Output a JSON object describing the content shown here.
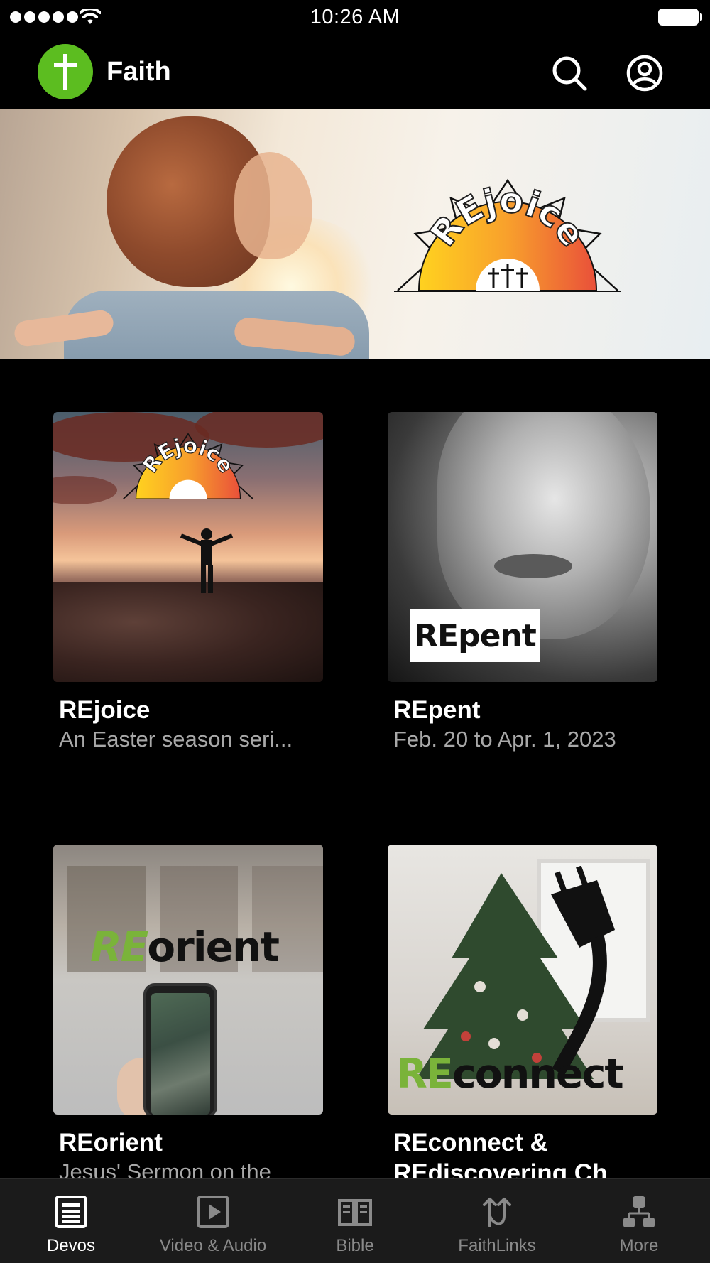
{
  "status_bar": {
    "time": "10:26 AM"
  },
  "header": {
    "app_name": "Faith",
    "logo_icon": "cross-icon",
    "search_icon": "search-icon",
    "profile_icon": "account-circle-icon",
    "accent_color": "#5cbd20"
  },
  "hero": {
    "logo_text": "REjoice"
  },
  "cards": [
    {
      "title": "REjoice",
      "subtitle": "An Easter season seri...",
      "art_text": "REjoice"
    },
    {
      "title": "REpent",
      "subtitle": "Feb. 20 to Apr. 1, 2023",
      "art_text": "REpent"
    },
    {
      "title": "REorient",
      "subtitle": "Jesus' Sermon on the",
      "art_text_re": "RE",
      "art_text_rest": "orient"
    },
    {
      "title": "REconnect &",
      "subtitle": "REdiscovering Ch",
      "art_text_re": "RE",
      "art_text_rest": "connect"
    }
  ],
  "tabs": [
    {
      "label": "Devos",
      "icon": "devos-icon",
      "active": true
    },
    {
      "label": "Video & Audio",
      "icon": "play-icon",
      "active": false
    },
    {
      "label": "Bible",
      "icon": "book-icon",
      "active": false
    },
    {
      "label": "FaithLinks",
      "icon": "faithlinks-icon",
      "active": false
    },
    {
      "label": "More",
      "icon": "more-icon",
      "active": false
    }
  ]
}
